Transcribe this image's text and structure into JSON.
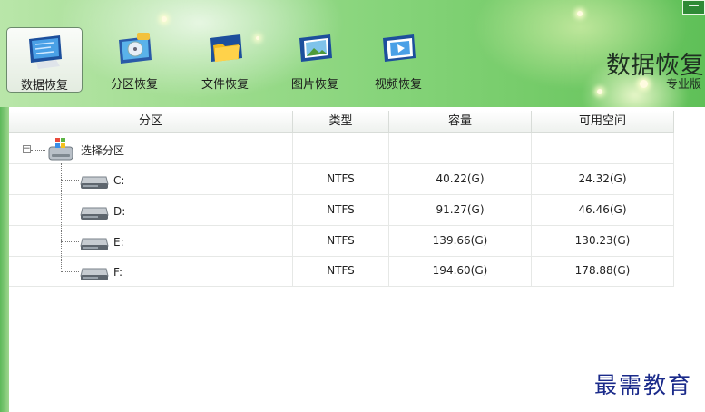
{
  "window": {
    "minimize_label": "—"
  },
  "toolbar": {
    "items": [
      {
        "label": "数据恢复",
        "icon": "monitor-data-icon",
        "active": true
      },
      {
        "label": "分区恢复",
        "icon": "partition-disk-icon",
        "active": false
      },
      {
        "label": "文件恢复",
        "icon": "folder-icon",
        "active": false
      },
      {
        "label": "图片恢复",
        "icon": "picture-icon",
        "active": false
      },
      {
        "label": "视频恢复",
        "icon": "film-icon",
        "active": false
      }
    ]
  },
  "brand": {
    "title": "数据恢复",
    "edition": "专业版"
  },
  "table": {
    "headers": [
      "分区",
      "类型",
      "容量",
      "可用空间"
    ],
    "root": {
      "label": "选择分区",
      "expander": "−"
    },
    "rows": [
      {
        "drive": "C:",
        "type": "NTFS",
        "capacity": "40.22(G)",
        "free": "24.32(G)"
      },
      {
        "drive": "D:",
        "type": "NTFS",
        "capacity": "91.27(G)",
        "free": "46.46(G)"
      },
      {
        "drive": "E:",
        "type": "NTFS",
        "capacity": "139.66(G)",
        "free": "130.23(G)"
      },
      {
        "drive": "F:",
        "type": "NTFS",
        "capacity": "194.60(G)",
        "free": "178.88(G)"
      }
    ]
  },
  "watermark": "最需教育"
}
